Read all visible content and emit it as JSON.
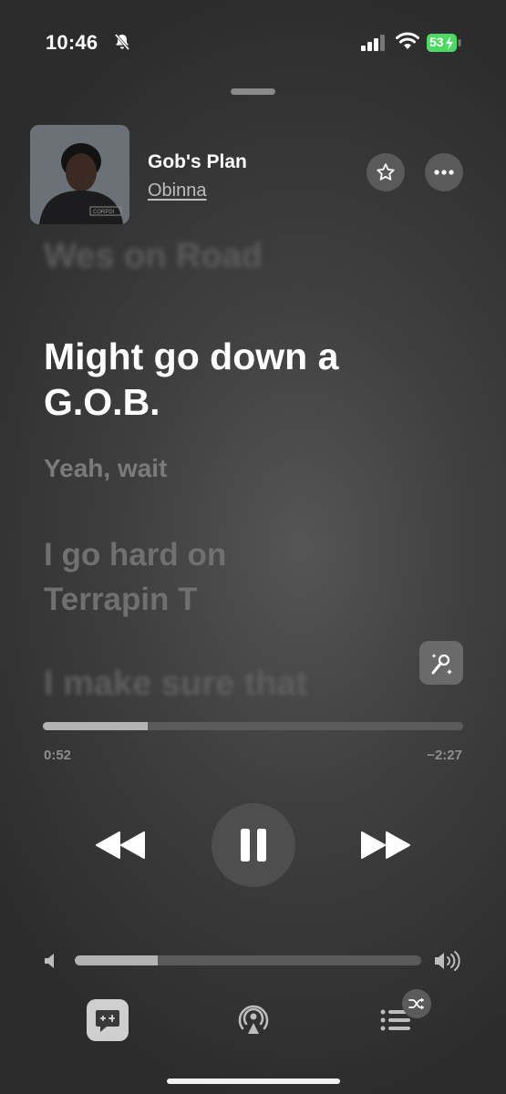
{
  "status_bar": {
    "time": "10:46",
    "battery_level": "53",
    "icons": [
      "bell-slash-icon",
      "cellular-signal-icon",
      "wifi-icon",
      "battery-charging-icon"
    ]
  },
  "now_playing": {
    "title": "Gob's Plan",
    "artist": "Obinna",
    "artwork_caption": "CORPDI"
  },
  "lyrics": {
    "previous": "Wes on Road",
    "current": "Might go down a G.O.B.",
    "next": [
      "Yeah, wait",
      "I go hard on Terrapin T",
      "I make sure that"
    ]
  },
  "playback": {
    "elapsed": "0:52",
    "remaining": "−2:27",
    "progress_fraction": 0.25,
    "state": "playing"
  },
  "volume": {
    "level_fraction": 0.24
  },
  "colors": {
    "accent": "#ffffff",
    "background": "#3a3a3a",
    "battery_green": "#4cd964"
  }
}
